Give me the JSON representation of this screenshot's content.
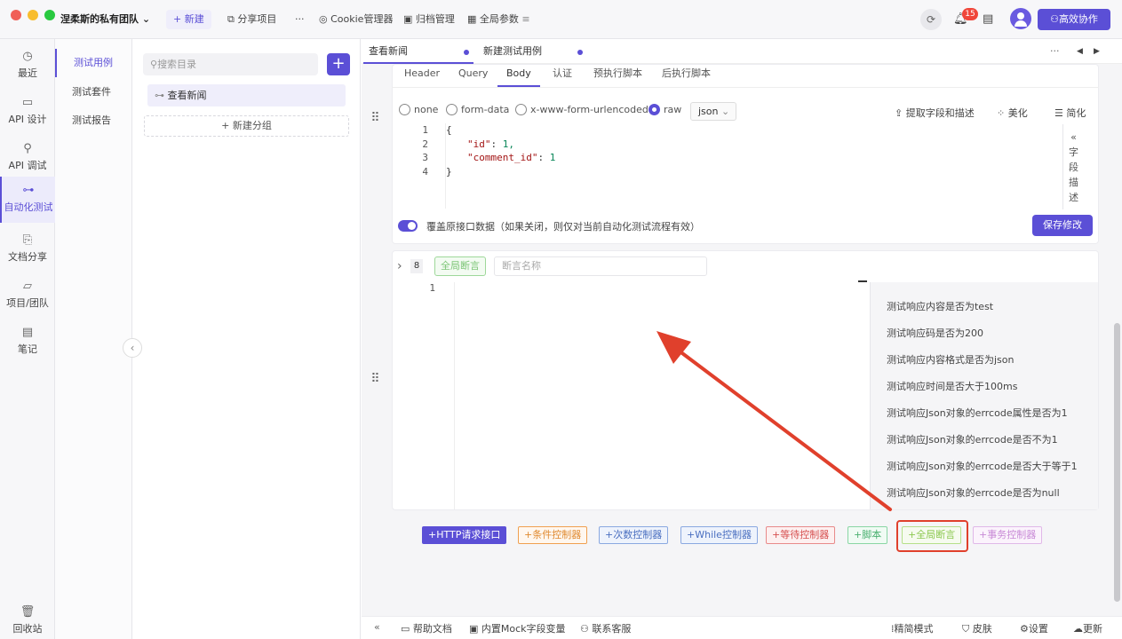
{
  "window": {
    "team_name": "涅柔斯的私有团队"
  },
  "topbar": {
    "new_label": "+ 新建",
    "share_label": "分享项目",
    "more_label": "···",
    "cookie_label": "Cookie管理器",
    "archive_label": "归档管理",
    "globals_label": "全局参数",
    "notification_count": "15",
    "collab_label": "高效协作"
  },
  "rail": {
    "items": [
      {
        "icon": "clock-icon",
        "label": "最近"
      },
      {
        "icon": "doc-icon",
        "label": "API 设计"
      },
      {
        "icon": "debug-icon",
        "label": "API 调试"
      },
      {
        "icon": "flow-icon",
        "label": "自动化测试",
        "active": true
      },
      {
        "icon": "share-doc-icon",
        "label": "文档分享"
      },
      {
        "icon": "folder-icon",
        "label": "项目/团队"
      },
      {
        "icon": "note-icon",
        "label": "笔记"
      }
    ],
    "trash_label": "回收站"
  },
  "subnav": {
    "items": [
      "测试用例",
      "测试套件",
      "测试报告"
    ]
  },
  "tree": {
    "search_placeholder": "搜索目录",
    "selected_item": "查看新闻",
    "new_group_label": "+ 新建分组"
  },
  "tabs": [
    {
      "label": "查看新闻",
      "dot": true
    },
    {
      "label": "新建测试用例",
      "dot": true
    }
  ],
  "request": {
    "subtabs": [
      "Header",
      "Query",
      "Body",
      "认证",
      "预执行脚本",
      "后执行脚本"
    ],
    "active_subtab": "Body",
    "body_types": [
      "none",
      "form-data",
      "x-www-form-urlencoded",
      "raw"
    ],
    "selected_body_type": "raw",
    "format": "json",
    "tools": [
      "提取字段和描述",
      "美化",
      "简化"
    ],
    "code_lines": [
      {
        "n": "1",
        "text": "{"
      },
      {
        "n": "2",
        "key": "\"id\"",
        "value": "1,"
      },
      {
        "n": "3",
        "key": "\"comment_id\"",
        "value": "1"
      },
      {
        "n": "4",
        "text": "}"
      }
    ],
    "side_panel_label": [
      "«",
      "字",
      "段",
      "描",
      "述"
    ],
    "override_label": "覆盖原接口数据（如果关闭，则仅对当前自动化测试流程有效）",
    "save_label": "保存修改"
  },
  "assert_step": {
    "step_number": "8",
    "tag_label": "全局断言",
    "name_placeholder": "断言名称",
    "line_number": "1",
    "suggestions": [
      "测试响应内容是否为test",
      "测试响应码是否为200",
      "测试响应内容格式是否为json",
      "测试响应时间是否大于100ms",
      "测试响应Json对象的errcode属性是否为1",
      "测试响应Json对象的errcode是否不为1",
      "测试响应Json对象的errcode是否大于等于1",
      "测试响应Json对象的errcode是否为null"
    ]
  },
  "controllers": [
    {
      "label": "+HTTP请求接口",
      "color": "#5b4fd6",
      "filled": true
    },
    {
      "label": "+条件控制器",
      "color": "#f0a050"
    },
    {
      "label": "+次数控制器",
      "color": "#6a8fd8"
    },
    {
      "label": "+While控制器",
      "color": "#6a8fd8"
    },
    {
      "label": "+等待控制器",
      "color": "#e46a6a"
    },
    {
      "label": "+脚本",
      "color": "#6cc58a"
    },
    {
      "label": "+全局断言",
      "color": "#a6d86a"
    },
    {
      "label": "+事务控制器",
      "color": "#d8a0e0"
    }
  ],
  "bottombar": {
    "collapse_glyph": "«",
    "left": [
      "帮助文档",
      "内置Mock字段变量",
      "联系客服"
    ],
    "right": [
      "精简模式",
      "皮肤",
      "设置",
      "更新"
    ]
  }
}
